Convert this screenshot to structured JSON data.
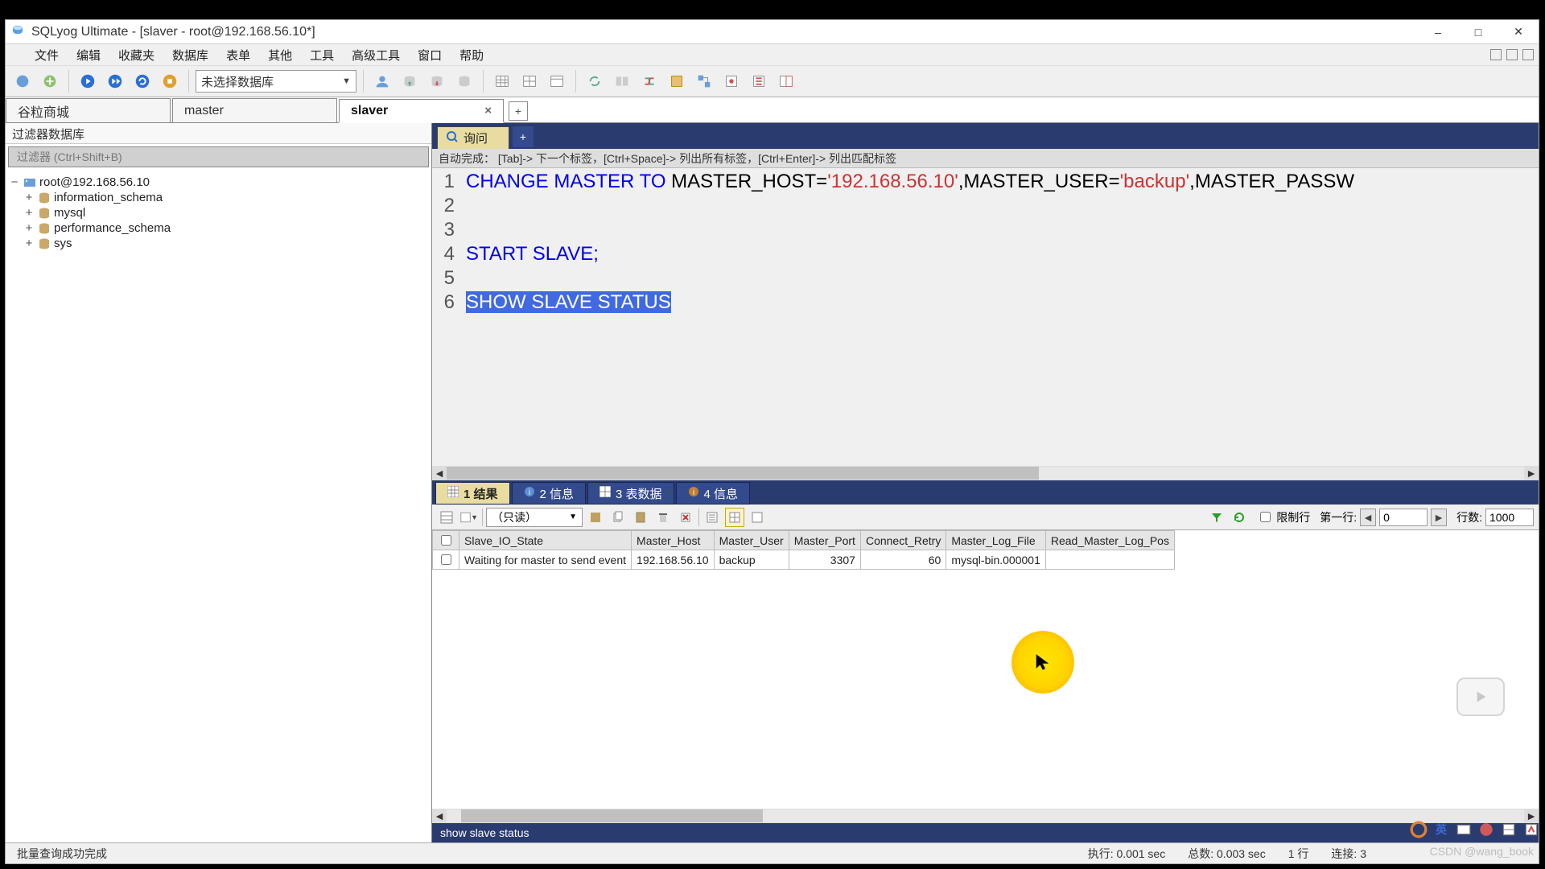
{
  "title": "SQLyog Ultimate - [slaver - root@192.168.56.10*]",
  "menus": [
    "文件",
    "编辑",
    "收藏夹",
    "数据库",
    "表单",
    "其他",
    "工具",
    "高级工具",
    "窗口",
    "帮助"
  ],
  "db_select_placeholder": "未选择数据库",
  "conn_tabs": [
    {
      "label": "谷粒商城",
      "active": false,
      "closable": false
    },
    {
      "label": "master",
      "active": false,
      "closable": false
    },
    {
      "label": "slaver",
      "active": true,
      "closable": true
    }
  ],
  "sidebar": {
    "filter_header": "过滤器数据库",
    "filter_placeholder": "过滤器 (Ctrl+Shift+B)",
    "root": "root@192.168.56.10",
    "databases": [
      "information_schema",
      "mysql",
      "performance_schema",
      "sys"
    ]
  },
  "query_tab_label": "询问",
  "hints": "自动完成：  [Tab]-> 下一个标签，[Ctrl+Space]-> 列出所有标签，[Ctrl+Enter]-> 列出匹配标签",
  "sql": {
    "line1_pre": "CHANGE MASTER TO ",
    "line1_mid": "MASTER_HOST=",
    "line1_host": "'192.168.56.10'",
    "line1_sep": ",",
    "line1_user_k": "MASTER_USER=",
    "line1_user_v": "'backup'",
    "line1_tail": ",MASTER_PASSW",
    "line4": "START SLAVE;",
    "line6": "SHOW SLAVE STATUS"
  },
  "result_tabs": [
    {
      "label": "1 结果",
      "active": true
    },
    {
      "label": "2 信息",
      "active": false
    },
    {
      "label": "3 表数据",
      "active": false
    },
    {
      "label": "4 信息",
      "active": false
    }
  ],
  "readonly_label": "（只读）",
  "limit_label": "限制行",
  "firstrow_label": "第一行:",
  "firstrow_value": "0",
  "rows_label": "行数:",
  "rows_value": "1000",
  "grid": {
    "headers": [
      "Slave_IO_State",
      "Master_Host",
      "Master_User",
      "Master_Port",
      "Connect_Retry",
      "Master_Log_File",
      "Read_Master_Log_Pos"
    ],
    "row": [
      "Waiting for master to send event",
      "192.168.56.10",
      "backup",
      "3307",
      "60",
      "mysql-bin.000001",
      ""
    ],
    "numeric_cols": [
      3,
      4
    ]
  },
  "result_status": "show slave status",
  "statusbar": {
    "msg": "批量查询成功完成",
    "exec": "执行: 0.001 sec",
    "total": "总数: 0.003 sec",
    "rows": "1 行",
    "conn": "连接: 3"
  },
  "watermark": "CSDN @wang_book",
  "tray_ime": "英"
}
